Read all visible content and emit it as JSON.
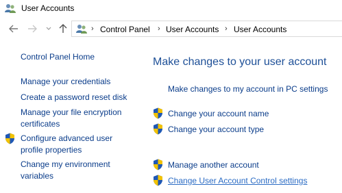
{
  "window": {
    "title": "User Accounts"
  },
  "breadcrumb": [
    "Control Panel",
    "User Accounts",
    "User Accounts"
  ],
  "sidebar": {
    "home": "Control Panel Home",
    "items": [
      {
        "label": "Manage your credentials",
        "shield": false
      },
      {
        "label": "Create a password reset disk",
        "shield": false
      },
      {
        "label": "Manage your file encryption certificates",
        "shield": false
      },
      {
        "label": "Configure advanced user profile properties",
        "shield": true
      },
      {
        "label": "Change my environment variables",
        "shield": false
      }
    ]
  },
  "main": {
    "heading": "Make changes to your user account",
    "pc_settings_link": "Make changes to my account in PC settings",
    "tasks": [
      {
        "label": "Change your account name",
        "shield": true
      },
      {
        "label": "Change your account type",
        "shield": true
      }
    ],
    "other_tasks": [
      {
        "label": "Manage another account",
        "shield": true
      },
      {
        "label": "Change User Account Control settings",
        "shield": true
      }
    ]
  },
  "colors": {
    "link": "#0a3c8a",
    "heading": "#1d4f97"
  }
}
